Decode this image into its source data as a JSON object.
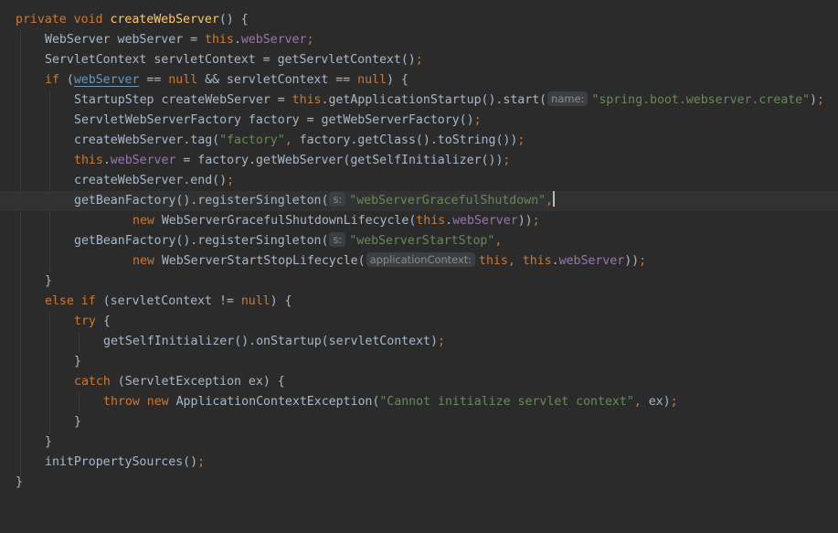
{
  "editor": {
    "lines": {
      "l1": {
        "kw1": "private",
        "kw2": "void",
        "fn": "createWebServer",
        "rest": "() {"
      },
      "l2": {
        "a": "WebServer webServer = ",
        "kw": "this",
        "dot": ".",
        "fld": "webServer",
        "semi": ";"
      },
      "l3": {
        "a": "ServletContext servletContext = getServletContext()",
        "semi": ";"
      },
      "l4": {
        "kw": "if",
        "a": " (",
        "ul": "webServer",
        "b": " == ",
        "kw2": "null",
        "c": " && servletContext == ",
        "kw3": "null",
        "d": ") {"
      },
      "l5": {
        "a": "StartupStep createWebServer = ",
        "kw": "this",
        "b": ".getApplicationStartup().start(",
        "hint": "name:",
        "str": "\"spring.boot.webserver.create\"",
        "c": ")",
        "semi": ";"
      },
      "l6": {
        "a": "ServletWebServerFactory factory = getWebServerFactory()",
        "semi": ";"
      },
      "l7": {
        "a": "createWebServer.tag(",
        "str": "\"factory\"",
        "comma": ",",
        "b": " factory.getClass().toString())",
        "semi": ";"
      },
      "l8": {
        "kw": "this",
        "dot": ".",
        "fld": "webServer",
        "a": " = factory.getWebServer(getSelfInitializer())",
        "semi": ";"
      },
      "l9": {
        "a": "createWebServer.end()",
        "semi": ";"
      },
      "l10": {
        "a": "getBeanFactory().registerSingleton(",
        "hint": "s:",
        "str": "\"webServerGracefulShutdown\"",
        "comma": ","
      },
      "l11": {
        "kw": "new",
        "a": " WebServerGracefulShutdownLifecycle(",
        "kw2": "this",
        "dot": ".",
        "fld": "webServer",
        "b": "))",
        "semi": ";"
      },
      "l12": {
        "a": "getBeanFactory().registerSingleton(",
        "hint": "s:",
        "str": "\"webServerStartStop\"",
        "comma": ","
      },
      "l13": {
        "kw": "new",
        "a": " WebServerStartStopLifecycle(",
        "hint": "applicationContext:",
        "kw2": "this",
        "comma": ",",
        "sp": " ",
        "kw3": "this",
        "dot": ".",
        "fld": "webServer",
        "b": "))",
        "semi": ";"
      },
      "l14": {
        "a": "}"
      },
      "l15": {
        "kw": "else if",
        "a": " (servletContext != ",
        "kw2": "null",
        "b": ") {"
      },
      "l16": {
        "kw": "try",
        "a": " {"
      },
      "l17": {
        "a": "getSelfInitializer().onStartup(servletContext)",
        "semi": ";"
      },
      "l18": {
        "a": "}"
      },
      "l19": {
        "kw": "catch",
        "a": " (ServletException ex) {"
      },
      "l20": {
        "kw": "throw",
        "kw2": "new",
        "a": " ApplicationContextException(",
        "str": "\"Cannot initialize servlet context\"",
        "comma": ",",
        "b": " ex)",
        "semi": ";"
      },
      "l21": {
        "a": "}"
      },
      "l22": {
        "a": "}"
      },
      "l23": {
        "a": "initPropertySources()",
        "semi": ";"
      },
      "l24": {
        "a": "}"
      }
    }
  }
}
